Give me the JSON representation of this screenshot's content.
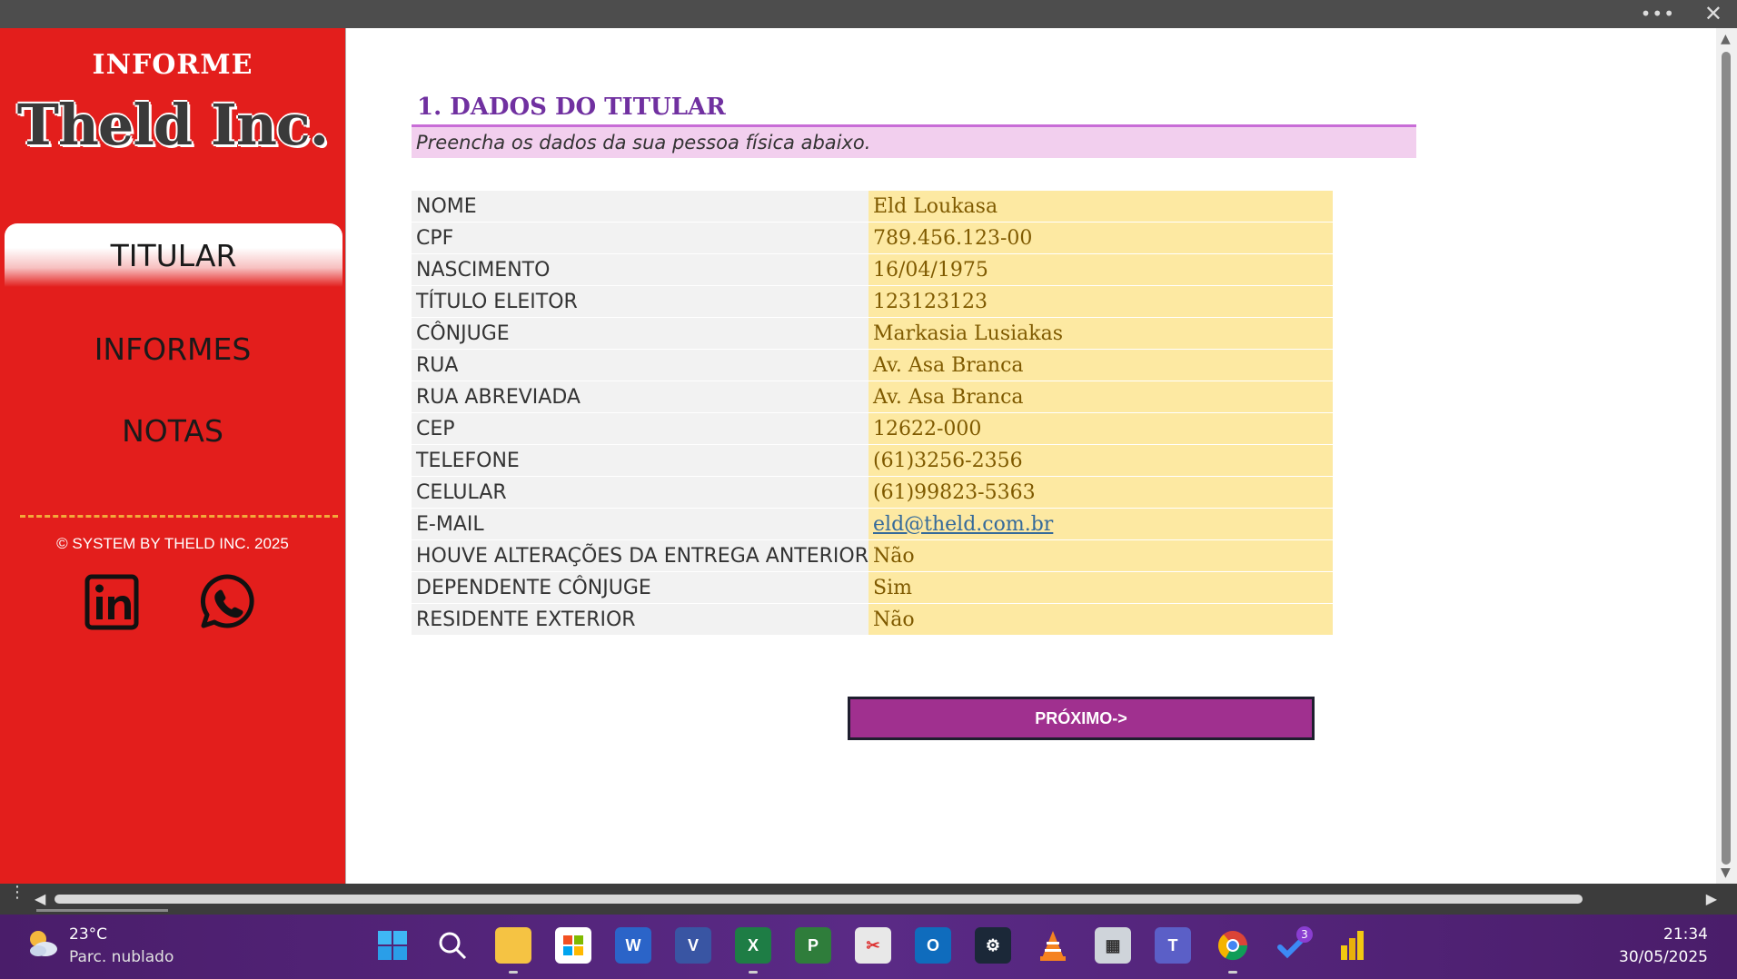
{
  "window": {
    "more_label": "•••",
    "close_label": "✕"
  },
  "sidebar": {
    "brand_small": "INFORME",
    "brand_big": "Theld Inc.",
    "nav": [
      {
        "label": "TITULAR",
        "active": true
      },
      {
        "label": "INFORMES",
        "active": false
      },
      {
        "label": "NOTAS",
        "active": false
      }
    ],
    "copyright": "© SYSTEM BY THELD INC. 2025",
    "social": [
      "linkedin-icon",
      "whatsapp-icon"
    ]
  },
  "section": {
    "title": "1. DADOS DO TITULAR",
    "subtitle": "Preencha os dados da sua pessoa física abaixo."
  },
  "form": {
    "rows": [
      {
        "label": "NOME",
        "value": "Eld Loukasa"
      },
      {
        "label": "CPF",
        "value": "789.456.123-00"
      },
      {
        "label": "NASCIMENTO",
        "value": "16/04/1975"
      },
      {
        "label": "TÍTULO ELEITOR",
        "value": "123123123"
      },
      {
        "label": "CÔNJUGE",
        "value": "Markasia Lusiakas"
      },
      {
        "label": "RUA",
        "value": "Av. Asa Branca"
      },
      {
        "label": "RUA ABREVIADA",
        "value": "Av. Asa Branca"
      },
      {
        "label": "CEP",
        "value": "12622-000"
      },
      {
        "label": "TELEFONE",
        "value": "(61)3256-2356"
      },
      {
        "label": "CELULAR",
        "value": "(61)99823-5363"
      },
      {
        "label": "E-MAIL",
        "value": "eld@theld.com.br"
      },
      {
        "label": "HOUVE ALTERAÇÕES DA ENTREGA ANTERIOR",
        "value": "Não"
      },
      {
        "label": "DEPENDENTE CÔNJUGE",
        "value": "Sim"
      },
      {
        "label": "RESIDENTE EXTERIOR",
        "value": "Não"
      }
    ],
    "next_label": "PRÓXIMO->"
  },
  "taskbar": {
    "temperature": "23°C",
    "condition": "Parc. nublado",
    "time": "21:34",
    "date": "30/05/2025",
    "apps": [
      "windows-start-icon",
      "search-icon",
      "file-explorer-icon",
      "microsoft-store-icon",
      "word-icon",
      "visio-icon",
      "excel-icon",
      "project-icon",
      "snipping-tool-icon",
      "outlook-icon",
      "steam-icon",
      "vlc-icon",
      "calculator-icon",
      "teams-icon",
      "chrome-icon",
      "todo-icon",
      "power-bi-icon"
    ],
    "todo_badge": "3"
  }
}
